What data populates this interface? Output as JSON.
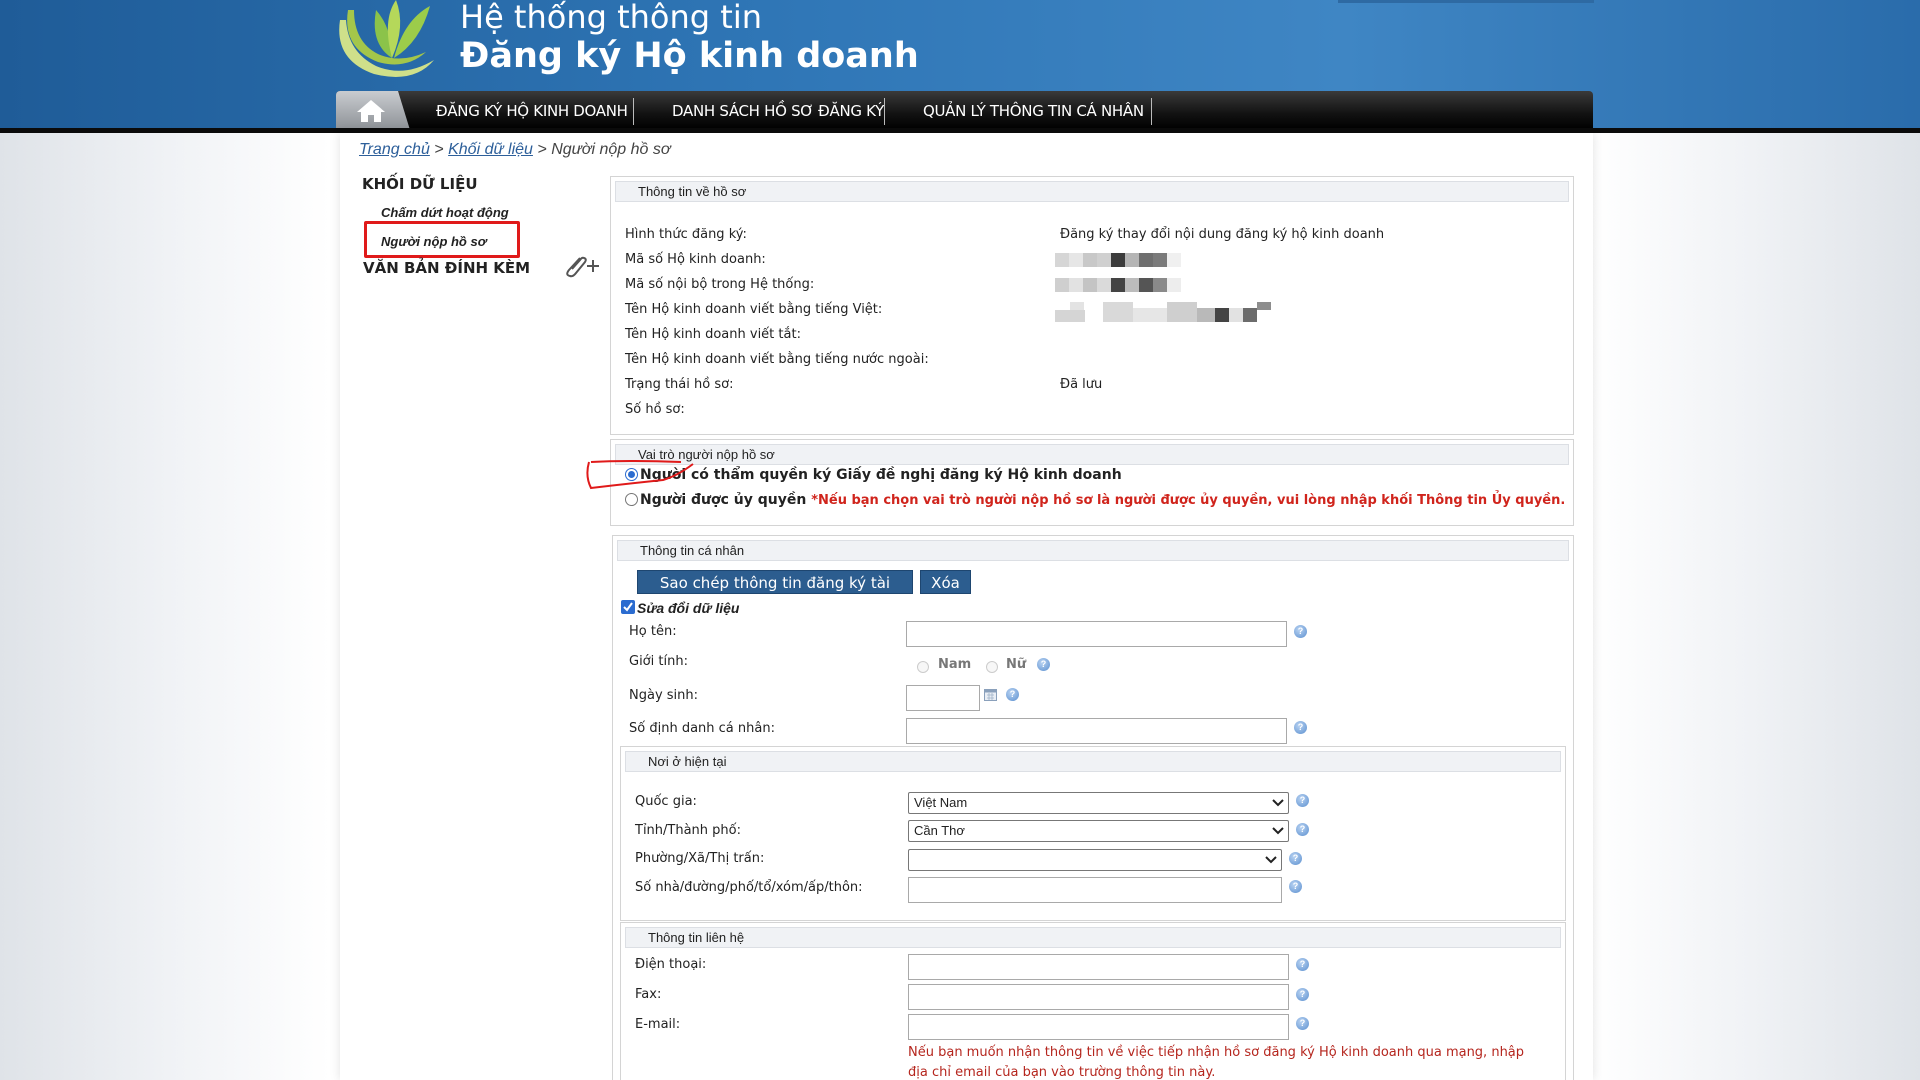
{
  "header": {
    "title_line1": "Hệ thống thông tin",
    "title_line2": "Đăng ký Hộ kinh doanh",
    "brand_color": "#2f76b6"
  },
  "nav": {
    "home_icon": "home-icon",
    "items": [
      {
        "label": "ĐĂNG KÝ HỘ KINH DOANH"
      },
      {
        "label": "DANH SÁCH HỒ SƠ ĐĂNG KÝ"
      },
      {
        "label": "QUẢN LÝ THÔNG TIN CÁ NHÂN"
      }
    ]
  },
  "breadcrumb": {
    "home": "Trang chủ",
    "sep1": " > ",
    "block": "Khối dữ liệu",
    "sep2": " > ",
    "current": "Người nộp hồ sơ"
  },
  "sidebar": {
    "section_title": "KHỐI DỮ LIỆU",
    "items": [
      {
        "label": "Chấm dứt hoạt động"
      },
      {
        "label": "Người nộp hồ sơ"
      }
    ],
    "attachments_title": "VĂN BẢN ĐÍNH KÈM",
    "attach_icon": "paperclip-plus-icon"
  },
  "dossier_info": {
    "legend": "Thông tin về hồ sơ",
    "rows": [
      {
        "label": "Hình thức đăng ký:",
        "value": "Đăng ký thay đổi nội dung đăng ký hộ kinh doanh"
      },
      {
        "label": "Mã số Hộ kinh doanh:",
        "value": ""
      },
      {
        "label": "Mã số nội bộ trong Hệ thống:",
        "value": ""
      },
      {
        "label": "Tên Hộ kinh doanh viết bằng tiếng Việt:",
        "value": ""
      },
      {
        "label": "Tên Hộ kinh doanh viết tắt:",
        "value": ""
      },
      {
        "label": "Tên Hộ kinh doanh viết bằng tiếng nước ngoài:",
        "value": ""
      },
      {
        "label": "Trạng thái hồ sơ:",
        "value": "Đã lưu"
      },
      {
        "label": "Số hồ sơ:",
        "value": ""
      }
    ]
  },
  "submitter_role": {
    "legend": "Vai trò người nộp hồ sơ",
    "option1": "Người có thẩm quyền ký Giấy đề nghị đăng ký Hộ kinh doanh",
    "option2": "Người được ủy quyền",
    "warning": "*Nếu bạn chọn vai trò người nộp hồ sơ là người được ủy quyền, vui lòng nhập khối Thông tin Ủy quyền.",
    "selected": 1
  },
  "personal_info": {
    "legend": "Thông tin cá nhân",
    "copy_button": "Sao chép thông tin đăng ký tài khoản",
    "delete_button": "Xóa",
    "edit_checkbox": "Sửa đổi dữ liệu",
    "edit_checked": true,
    "full_name": {
      "label": "Họ tên:",
      "value": ""
    },
    "gender": {
      "label": "Giới tính:",
      "male": "Nam",
      "female": "Nữ"
    },
    "dob": {
      "label": "Ngày sinh:",
      "value": ""
    },
    "personal_id": {
      "label": "Số định danh cá nhân:",
      "value": ""
    }
  },
  "residence": {
    "legend": "Nơi ở hiện tại",
    "country": {
      "label": "Quốc gia:",
      "value": "Việt Nam"
    },
    "province": {
      "label": "Tỉnh/Thành phố:",
      "value": "Cần Thơ"
    },
    "ward": {
      "label": "Phường/Xã/Thị trấn:",
      "value": ""
    },
    "address": {
      "label": "Số nhà/đường/phố/tổ/xóm/ấp/thôn:",
      "value": ""
    }
  },
  "contact": {
    "legend": "Thông tin liên hệ",
    "phone": {
      "label": "Điện thoại:",
      "value": ""
    },
    "fax": {
      "label": "Fax:",
      "value": ""
    },
    "email": {
      "label": "E-mail:",
      "value": ""
    },
    "note": "Nếu bạn muốn nhận thông tin về việc tiếp nhận hồ sơ đăng ký Hộ kinh doanh qua mạng, nhập địa chỉ email của bạn vào trường thông tin này."
  }
}
